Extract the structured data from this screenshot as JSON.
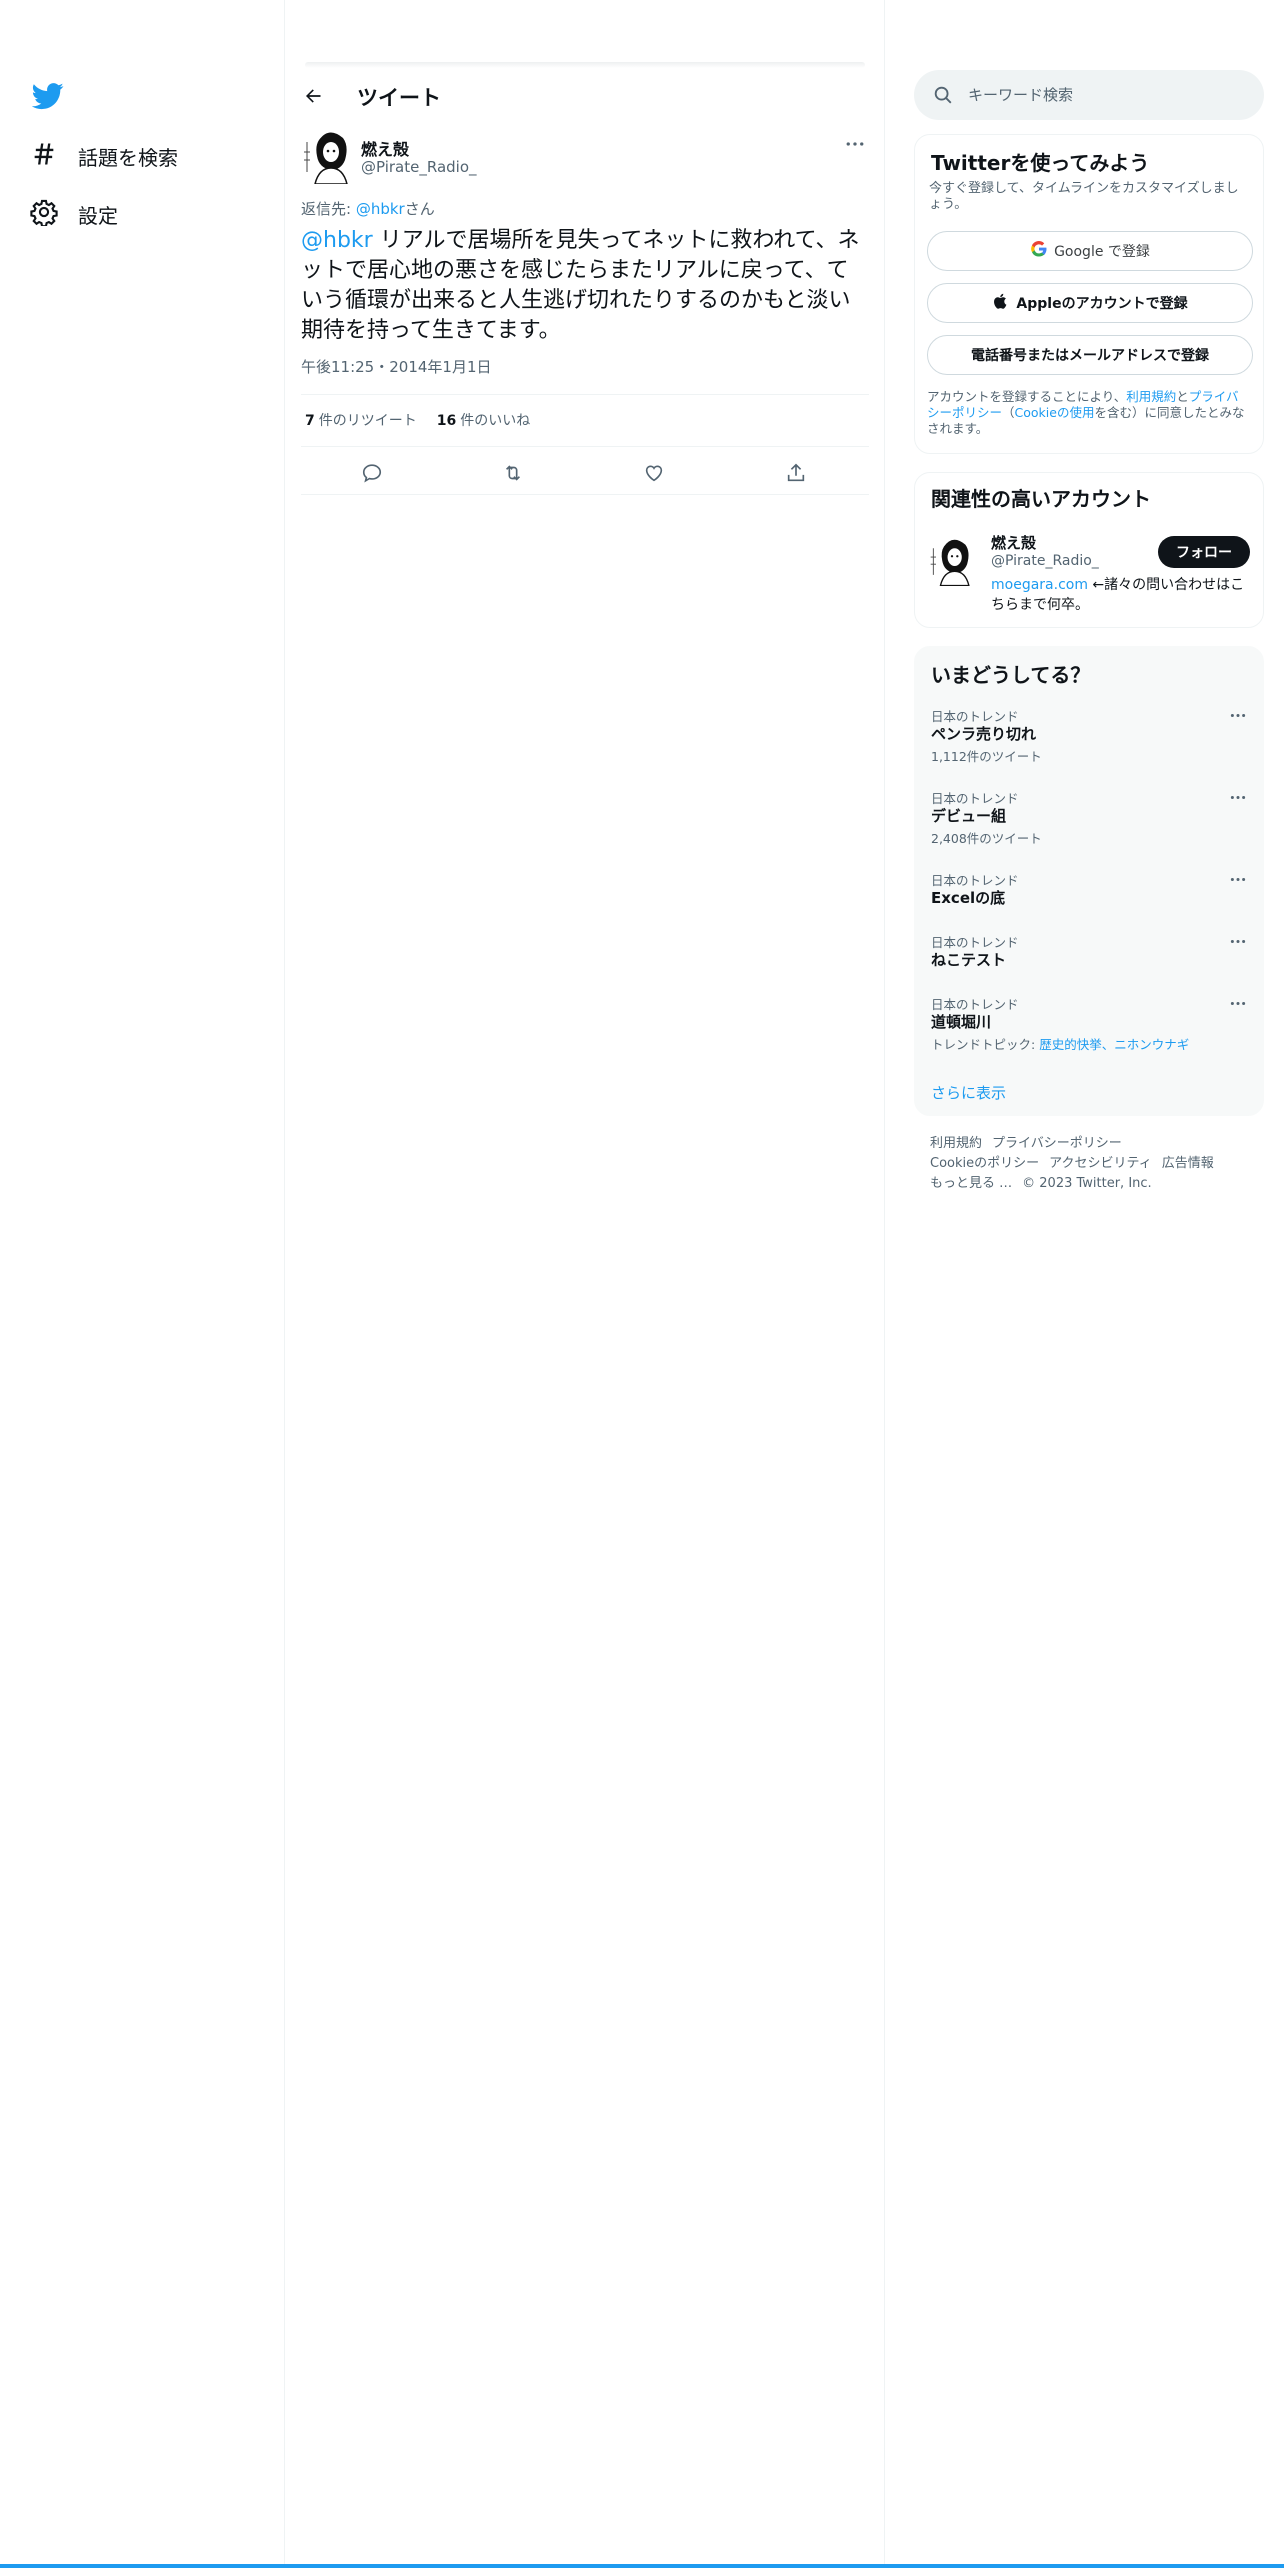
{
  "nav": {
    "items": [
      {
        "label": "話題を検索",
        "icon": "hashtag-icon"
      },
      {
        "label": "設定",
        "icon": "gear-icon"
      }
    ]
  },
  "header": {
    "title": "ツイート"
  },
  "tweet": {
    "name": "燃え殻",
    "handle": "@Pirate_Radio_",
    "reply_prefix": "返信先: ",
    "reply_to": "@hbkr",
    "reply_suffix": "さん",
    "mention": "@hbkr",
    "text": " リアルで居場所を見失ってネットに救われて、ネットで居心地の悪さを感じたらまたリアルに戻って、ていう循環が出来ると人生逃げ切れたりするのかもと淡い期待を持って生きてます。",
    "time": "午後11:25",
    "separator": "・",
    "date": "2014年1月1日",
    "retweets_count": "7",
    "retweets_label": "件のリツイート",
    "likes_count": "16",
    "likes_label": "件のいいね"
  },
  "search": {
    "placeholder": "キーワード検索"
  },
  "signup": {
    "title": "Twitterを使ってみよう",
    "subtitle": "今すぐ登録して、タイムラインをカスタマイズしましょう。",
    "google": "Google で登録",
    "apple": "Appleのアカウントで登録",
    "phone": "電話番号またはメールアドレスで登録",
    "legal_1": "アカウントを登録することにより、",
    "legal_terms": "利用規約",
    "legal_2": "と",
    "legal_privacy": "プライバシーポリシー",
    "legal_3": "（",
    "legal_cookie": "Cookieの使用",
    "legal_4": "を含む）に同意したとみなされます。"
  },
  "related": {
    "title": "関連性の高いアカウント",
    "name": "燃え殻",
    "handle": "@Pirate_Radio_",
    "bio_link": "moegara.com",
    "bio_text": " ←諸々の問い合わせはこちらまで何卒。",
    "follow": "フォロー"
  },
  "trends": {
    "title": "いまどうしてる？",
    "items": [
      {
        "category": "日本のトレンド",
        "name": "ペンラ売り切れ",
        "count": "1,112件のツイート"
      },
      {
        "category": "日本のトレンド",
        "name": "デビュー組",
        "count": "2,408件のツイート"
      },
      {
        "category": "日本のトレンド",
        "name": "Excelの底",
        "count": ""
      },
      {
        "category": "日本のトレンド",
        "name": "ねこテスト",
        "count": ""
      },
      {
        "category": "日本のトレンド",
        "name": "道頓堀川",
        "topic_label": "トレンドトピック: ",
        "topic": "歴史的快挙、ニホンウナギ"
      }
    ],
    "show_more": "さらに表示"
  },
  "footer": {
    "terms": "利用規約",
    "privacy": "プライバシーポリシー",
    "cookie": "Cookieのポリシー",
    "accessibility": "アクセシビリティ",
    "ads": "広告情報",
    "more": "もっと見る …",
    "copyright": "© 2023 Twitter, Inc."
  },
  "colors": {
    "accent": "#1d9bf0",
    "text": "#0f1419",
    "secondary": "#536471"
  }
}
